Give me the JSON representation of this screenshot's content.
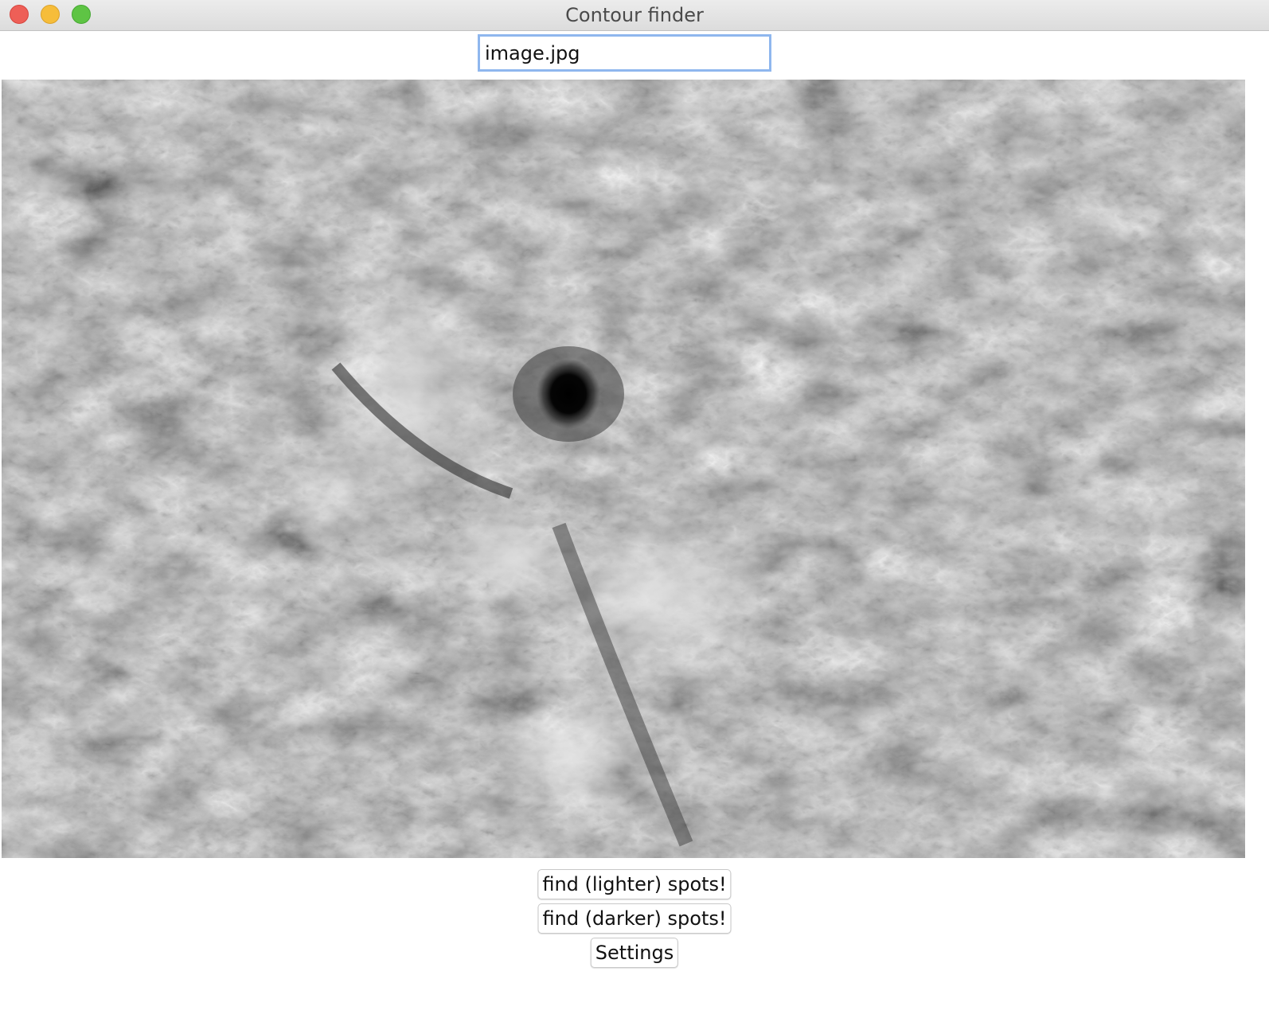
{
  "window": {
    "title": "Contour finder",
    "controls": [
      "close",
      "minimize",
      "zoom"
    ]
  },
  "file_input": {
    "value": "image.jpg"
  },
  "image": {
    "icon": "grayscale-solar-image"
  },
  "buttons": {
    "find_lighter": "find (lighter) spots!",
    "find_darker": "find (darker) spots!",
    "settings": "Settings"
  },
  "colors": {
    "close": "#ee5f57",
    "minimize": "#f6bd3a",
    "zoom": "#5ec444",
    "focus_ring": "#8fb7ee"
  }
}
